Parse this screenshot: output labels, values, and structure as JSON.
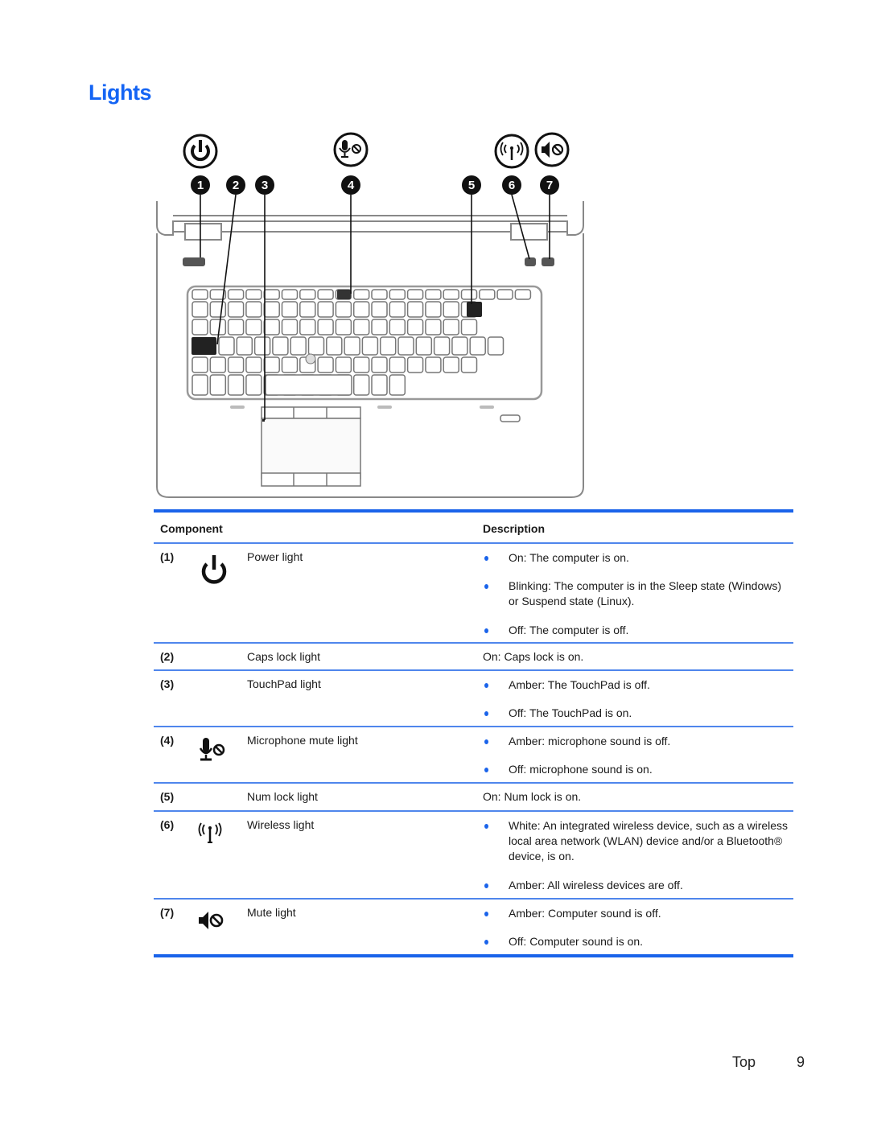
{
  "page": {
    "title": "Lights",
    "footer_section": "Top",
    "footer_page": "9",
    "accent_color": "#1464f4"
  },
  "figure": {
    "callouts": [
      "1",
      "2",
      "3",
      "4",
      "5",
      "6",
      "7"
    ],
    "icons": [
      "power-icon",
      "microphone-mute-icon",
      "wireless-icon",
      "mute-icon"
    ]
  },
  "table": {
    "headers": {
      "component": "Component",
      "description": "Description"
    },
    "rows": [
      {
        "num": "(1)",
        "icon": "power-icon",
        "name": "Power light",
        "bullets": [
          "On: The computer is on.",
          "Blinking: The computer is in the Sleep state (Windows) or Suspend state (Linux).",
          "Off: The computer is off."
        ]
      },
      {
        "num": "(2)",
        "icon": "",
        "name": "Caps lock light",
        "text": "On: Caps lock is on."
      },
      {
        "num": "(3)",
        "icon": "",
        "name": "TouchPad light",
        "bullets": [
          "Amber: The TouchPad is off.",
          "Off: The TouchPad is on."
        ]
      },
      {
        "num": "(4)",
        "icon": "microphone-mute-icon",
        "name": "Microphone mute light",
        "bullets": [
          "Amber: microphone sound is off.",
          "Off: microphone sound is on."
        ]
      },
      {
        "num": "(5)",
        "icon": "",
        "name": "Num lock light",
        "text": "On: Num lock is on."
      },
      {
        "num": "(6)",
        "icon": "wireless-icon",
        "name": "Wireless light",
        "bullets": [
          "White: An integrated wireless device, such as a wireless local area network (WLAN) device and/or a Bluetooth® device, is on.",
          "Amber: All wireless devices are off."
        ]
      },
      {
        "num": "(7)",
        "icon": "mute-icon",
        "name": "Mute light",
        "bullets": [
          "Amber: Computer sound is off.",
          "Off: Computer sound is on."
        ]
      }
    ]
  }
}
